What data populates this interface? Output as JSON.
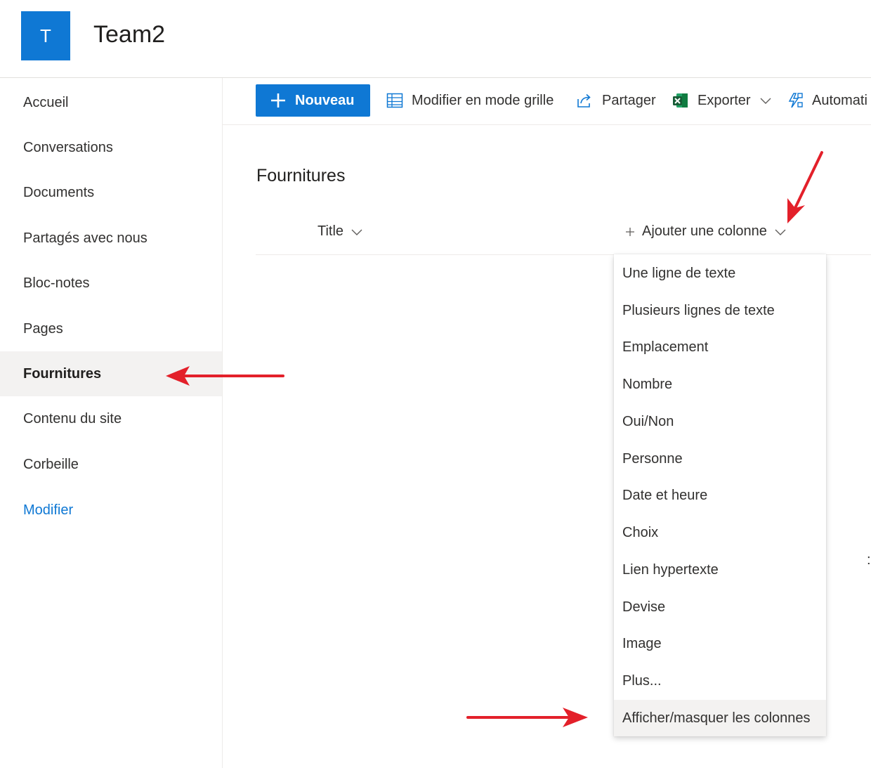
{
  "header": {
    "logo_letter": "T",
    "site_title": "Team2"
  },
  "sidebar": {
    "items": [
      {
        "label": "Accueil"
      },
      {
        "label": "Conversations"
      },
      {
        "label": "Documents"
      },
      {
        "label": "Partagés avec nous"
      },
      {
        "label": "Bloc-notes"
      },
      {
        "label": "Pages"
      },
      {
        "label": "Fournitures",
        "selected": true
      },
      {
        "label": "Contenu du site"
      },
      {
        "label": "Corbeille"
      },
      {
        "label": "Modifier",
        "link": true
      }
    ]
  },
  "command_bar": {
    "new_label": "Nouveau",
    "grid_label": "Modifier en mode grille",
    "share_label": "Partager",
    "export_label": "Exporter",
    "automate_label": "Automati"
  },
  "list": {
    "title": "Fournitures",
    "columns": {
      "title_label": "Title",
      "add_column_label": "Ajouter une colonne"
    }
  },
  "column_menu": {
    "items": [
      "Une ligne de texte",
      "Plusieurs lignes de texte",
      "Emplacement",
      "Nombre",
      "Oui/Non",
      "Personne",
      "Date et heure",
      "Choix",
      "Lien hypertexte",
      "Devise",
      "Image",
      "Plus..."
    ],
    "footer_item": "Afficher/masquer les colonnes"
  },
  "colors": {
    "accent": "#0f78d4",
    "annotation": "#e3202a",
    "selected_bg": "#f3f2f1"
  }
}
